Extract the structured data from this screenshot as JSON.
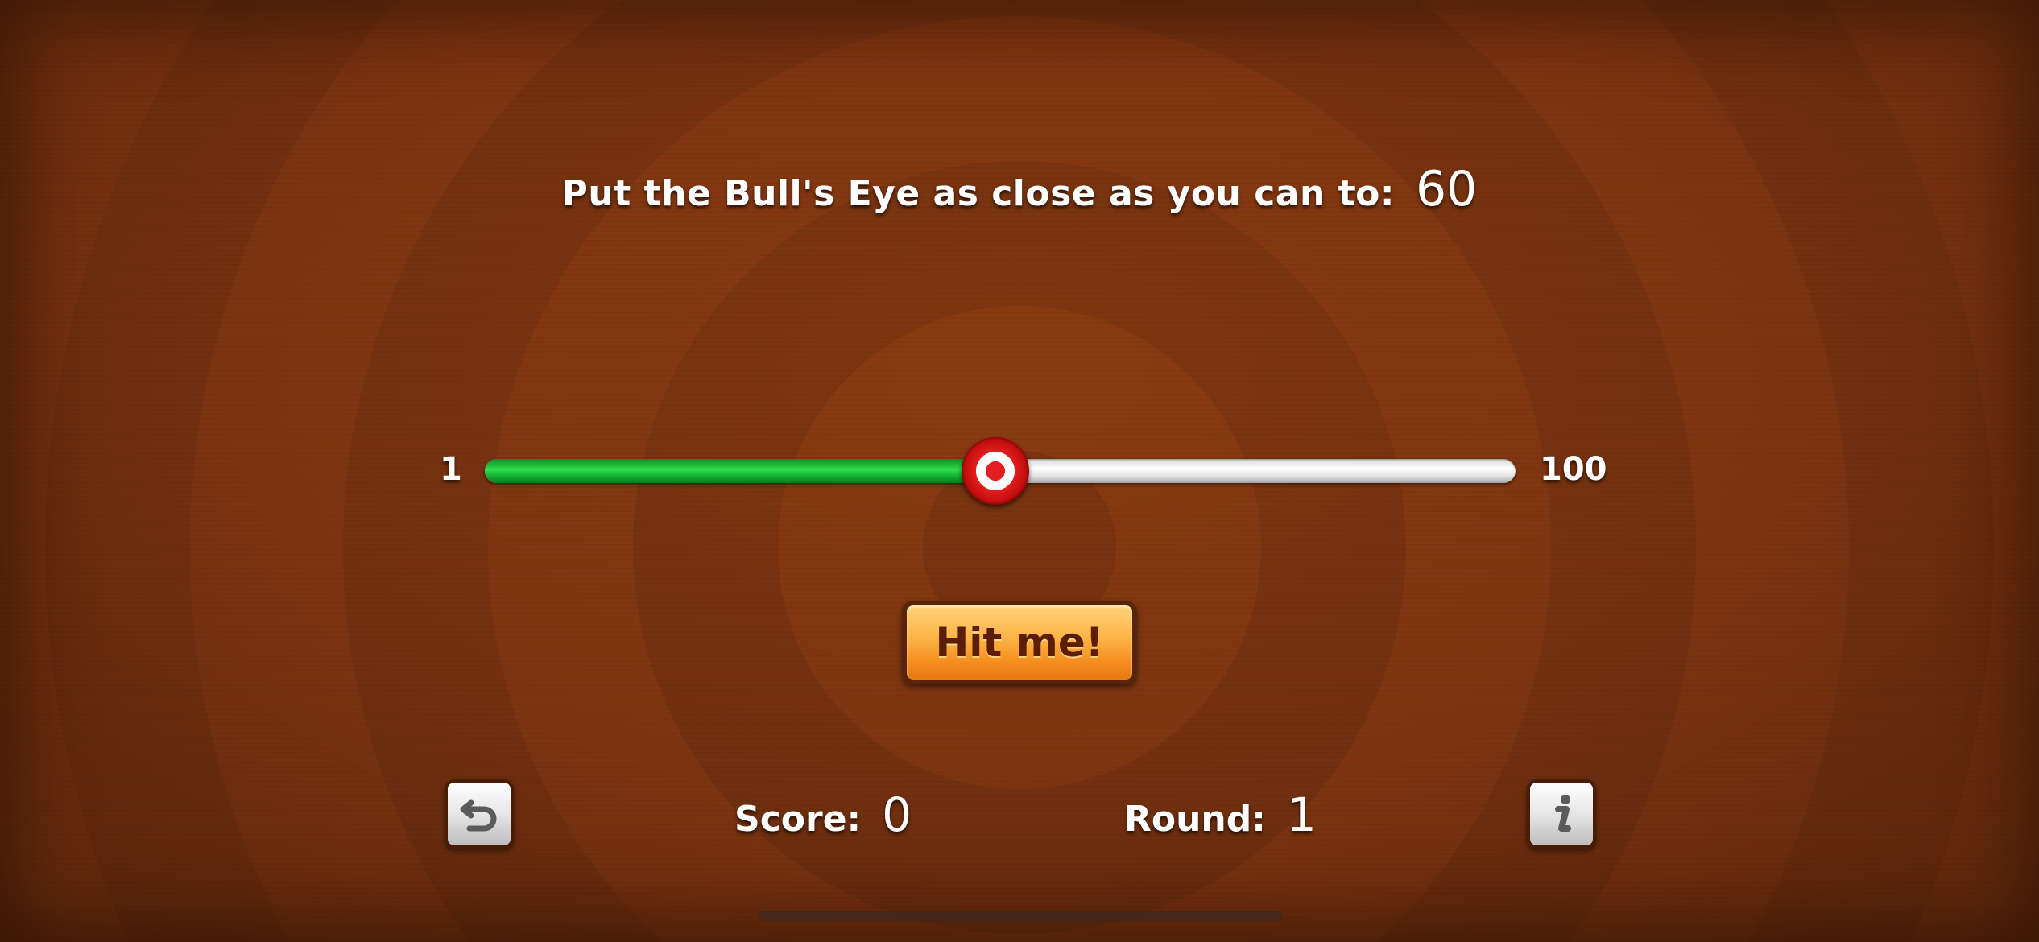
{
  "target": {
    "label": "Put the Bull's Eye as close as you can to:",
    "value": "60"
  },
  "slider": {
    "min_label": "1",
    "max_label": "100",
    "min": 1,
    "max": 100,
    "value": 50,
    "fill_color": "#1fc23a",
    "thumb_icon": "bullseye-icon"
  },
  "hit_button": {
    "label": "Hit me!"
  },
  "score": {
    "label": "Score:",
    "value": "0"
  },
  "round": {
    "label": "Round:",
    "value": "1"
  },
  "icons": {
    "restart": "restart-icon",
    "info": "info-icon"
  },
  "colors": {
    "background": "#7a3411",
    "button_orange": "#fdb346",
    "button_text": "#5c1f06"
  }
}
